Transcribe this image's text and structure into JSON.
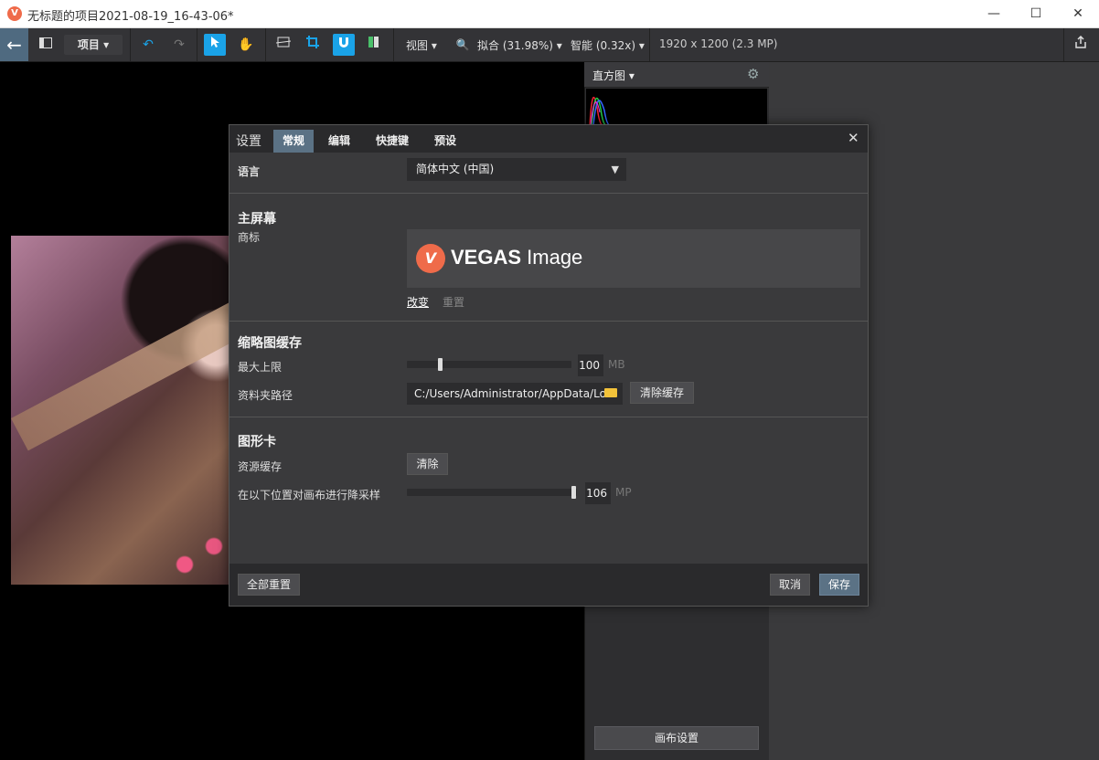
{
  "window": {
    "logo_glyph": "V",
    "title": "无标题的项目2021-08-19_16-43-06*",
    "min": "—",
    "max": "☐",
    "close": "✕"
  },
  "toolbar": {
    "back": "←",
    "project_menu": "项目 ▾",
    "view_menu": "视图 ▾",
    "fit_menu": "拟合 (31.98%) ▾",
    "smart_menu": "智能 (0.32x) ▾",
    "image_info": "1920 x 1200 (2.3 MP)"
  },
  "panel": {
    "histogram_label": "直方图 ▾",
    "canvas_settings": "画布设置"
  },
  "dialog": {
    "title": "设置",
    "tabs": [
      "常规",
      "编辑",
      "快捷键",
      "预设"
    ],
    "close": "✕",
    "language_label": "语言",
    "language_value": "简体中文 (中国)",
    "home_screen_title": "主屏幕",
    "logo_label": "商标",
    "logo_mark": "V",
    "logo_word_bold": "VEGAS",
    "logo_word_light": " Image",
    "change_link": "改变",
    "reset_link": "重置",
    "thumb_cache_title": "缩略图缓存",
    "max_limit_label": "最大上限",
    "max_limit_value": "100",
    "max_limit_unit": "MB",
    "max_limit_fraction": 0.2,
    "folder_path_label": "资料夹路径",
    "folder_path_value": "C:/Users/Administrator/AppData/Lo",
    "clear_cache_button": "清除缓存",
    "gpu_title": "图形卡",
    "resource_cache_label": "资源缓存",
    "clear_button": "清除",
    "downsample_label": "在以下位置对画布进行降采样",
    "downsample_value": "106",
    "downsample_unit": "MP",
    "downsample_fraction": 1.0,
    "reset_all_button": "全部重置",
    "cancel_button": "取消",
    "save_button": "保存"
  },
  "colors": {
    "accent": "#1aa3e8",
    "tab_active": "#5b7285",
    "brand": "#ef6b4a"
  }
}
